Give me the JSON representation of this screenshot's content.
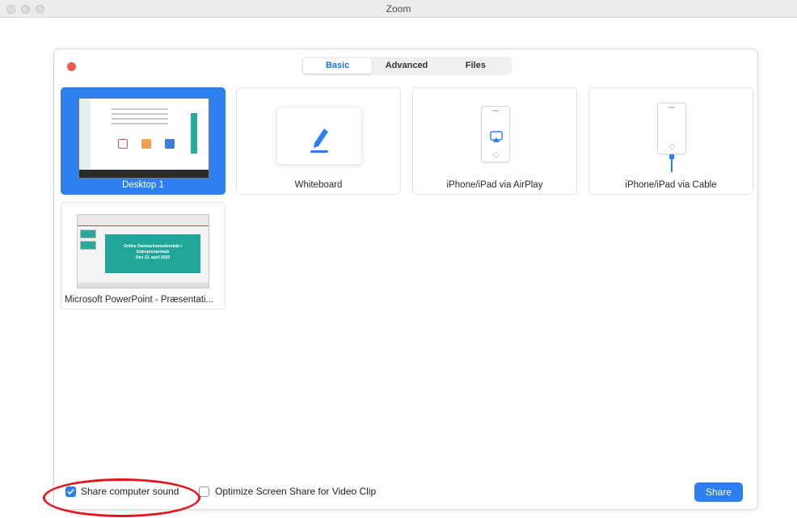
{
  "window": {
    "title": "Zoom"
  },
  "tabs": [
    {
      "label": "Basic",
      "active": true
    },
    {
      "label": "Advanced",
      "active": false
    },
    {
      "label": "Files",
      "active": false
    }
  ],
  "sources": [
    {
      "label": "Desktop 1",
      "selected": true,
      "kind": "desktop-icon"
    },
    {
      "label": "Whiteboard",
      "selected": false,
      "kind": "pencil-icon"
    },
    {
      "label": "iPhone/iPad via AirPlay",
      "selected": false,
      "kind": "airplay-icon"
    },
    {
      "label": "iPhone/iPad via Cable",
      "selected": false,
      "kind": "cable-icon"
    },
    {
      "label": "Microsoft PowerPoint - Præsentati...",
      "selected": false,
      "kind": "powerpoint-window"
    }
  ],
  "ppt_slide_text": [
    "Online Danmarksmesterskab i",
    "Entreprenørskab",
    "Den 22. april 2020"
  ],
  "options": {
    "share_sound": {
      "label": "Share computer sound",
      "checked": true
    },
    "optimize_video": {
      "label": "Optimize Screen Share for Video Clip",
      "checked": false
    }
  },
  "share_button": "Share",
  "colors": {
    "accent": "#2d7ff0",
    "close_dot": "#ee5b51",
    "annotation": "#e0171f",
    "slide_teal": "#23a69a"
  }
}
